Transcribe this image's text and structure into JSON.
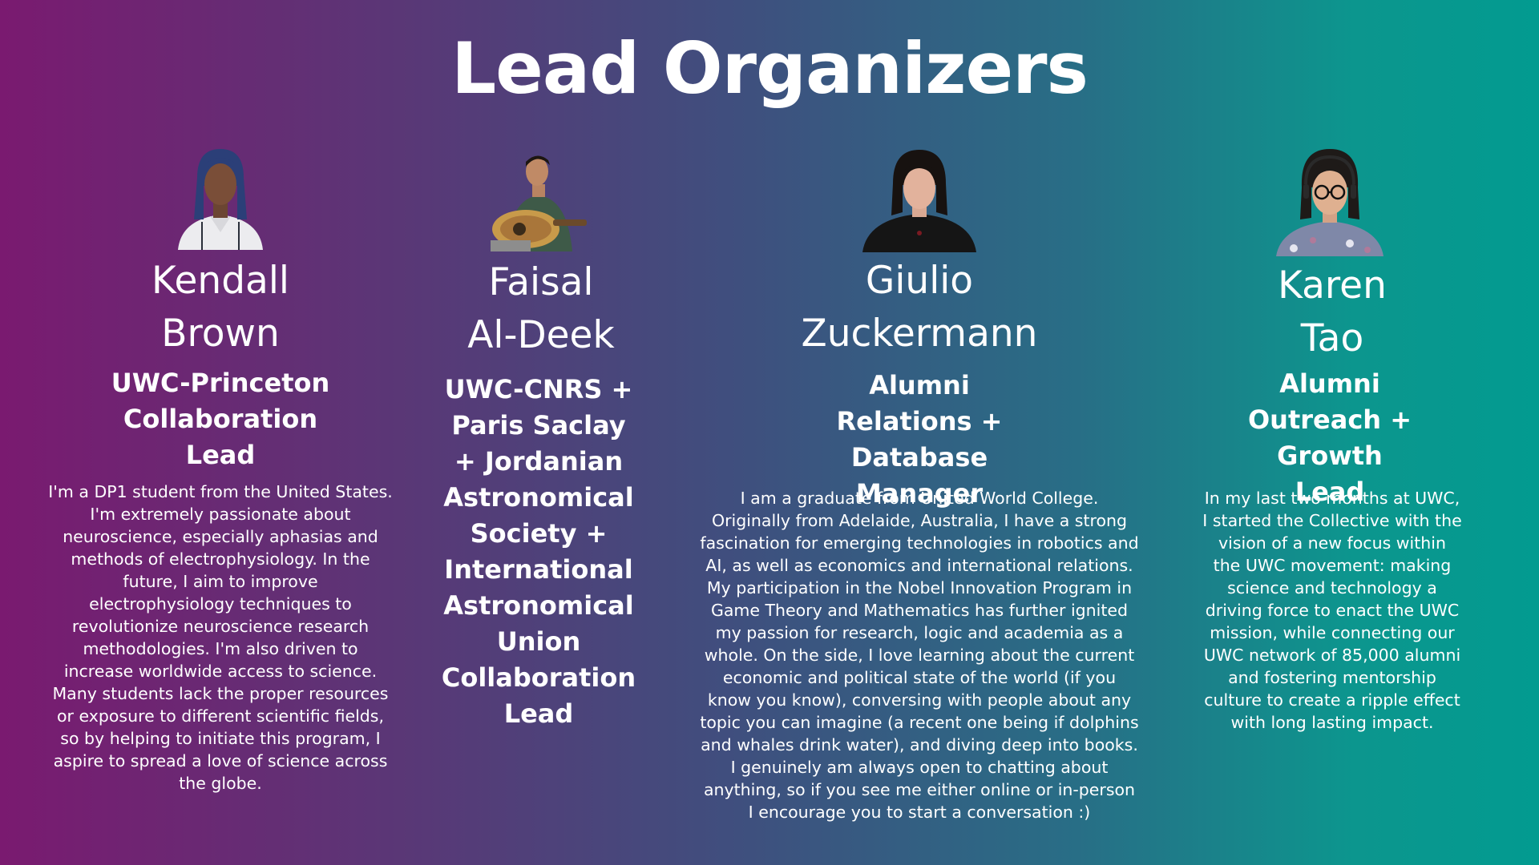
{
  "page": {
    "title": "Lead Organizers"
  },
  "organizers": [
    {
      "name_line1": "Kendall",
      "name_line2": "Brown",
      "role": "UWC-Princeton Collaboration Lead",
      "bio": "I'm a DP1 student from the United States. I'm extremely passionate about neuroscience, especially aphasias and methods of electrophysiology. In the future, I aim to improve electrophysiology techniques to revolutionize neuroscience research methodologies. I'm also driven to increase worldwide access to science. Many students lack the proper resources or exposure to different scientific fields, so by helping to initiate this program, I aspire to spread a love of science across the globe."
    },
    {
      "name_line1": "Faisal",
      "name_line2": "Al-Deek",
      "role": "UWC-CNRS + Paris Saclay + Jordanian Astronomical Society + International Astronomical Union Collaboration Lead",
      "bio": ""
    },
    {
      "name_line1": "Giulio",
      "name_line2": "Zuckermann",
      "role": "Alumni Relations + Database Manager",
      "bio": "I am a graduate from United World College. Originally from Adelaide, Australia, I have a strong fascination for emerging technologies in robotics and AI, as well as economics and international relations. My participation in the Nobel Innovation Program in Game Theory and Mathematics has further ignited my passion for research, logic and academia as a whole. On the side, I love learning about the current economic and political state of the world (if you know you know), conversing with people about any topic you can imagine (a recent one being if dolphins and whales drink water), and diving deep into books. I genuinely am always open to chatting about anything, so if you see me either online or in-person I encourage you to start a conversation :)"
    },
    {
      "name_line1": "Karen",
      "name_line2": "Tao",
      "role": "Alumni Outreach + Growth Lead",
      "bio": "In my last two months at UWC, I started the Collective with the vision of a new focus within the UWC movement: making science and technology a driving force to enact the UWC mission, while connecting our UWC network of 85,000 alumni and fostering mentorship culture to create a ripple effect with long lasting impact."
    }
  ]
}
